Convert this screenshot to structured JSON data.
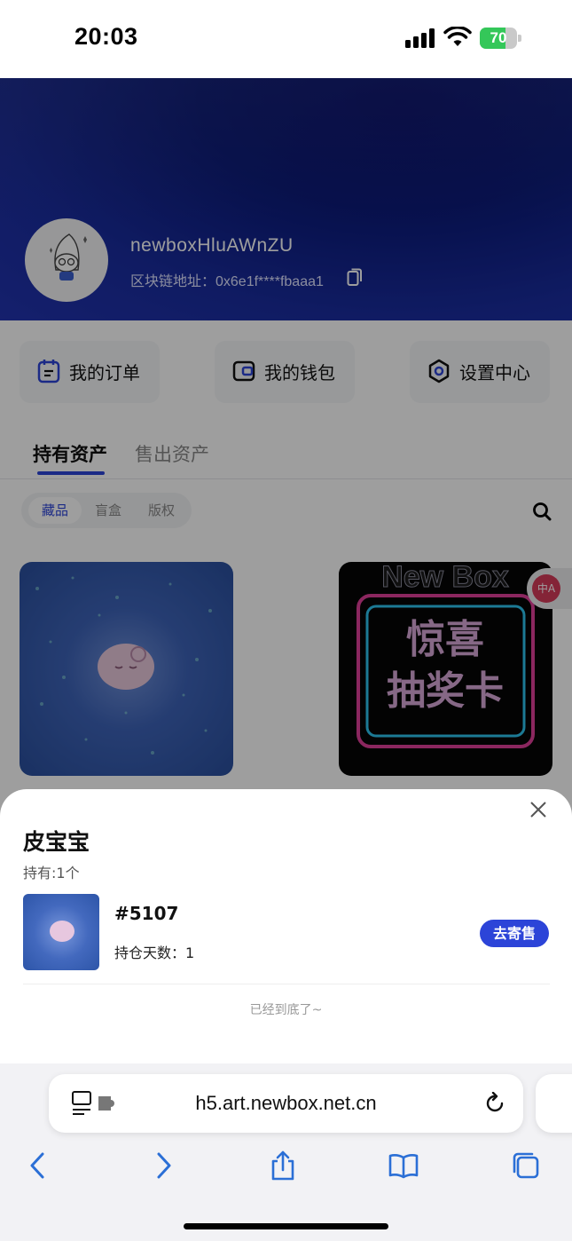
{
  "status_bar": {
    "time": "20:03",
    "battery": "70",
    "battery_level": 0.7
  },
  "profile": {
    "username": "newboxHluAWnZU",
    "chain_address": "区块链地址：0x6e1f****fbaaa1"
  },
  "quick_actions": [
    {
      "label": "我的订单",
      "icon": "order-icon"
    },
    {
      "label": "我的钱包",
      "icon": "wallet-icon"
    },
    {
      "label": "设置中心",
      "icon": "settings-icon"
    }
  ],
  "tabs": [
    "持有资产",
    "售出资产"
  ],
  "segments": [
    "藏品",
    "盲盒",
    "版权"
  ],
  "cards": [
    {
      "name": "皮宝宝"
    },
    {
      "name": "惊喜抽奖卡",
      "brand": "New Box",
      "text_line1": "惊喜",
      "text_line2": "抽奖卡"
    }
  ],
  "sheet": {
    "title": "皮宝宝",
    "holding": "持有:1个",
    "item": {
      "id": "#5107",
      "days": "持仓天数：1",
      "action": "去寄售"
    },
    "end_text": "已经到底了~"
  },
  "browser": {
    "url": "h5.art.newbox.net.cn"
  },
  "colors": {
    "accent": "#2c44d8",
    "hero": "#0b1a7a"
  }
}
